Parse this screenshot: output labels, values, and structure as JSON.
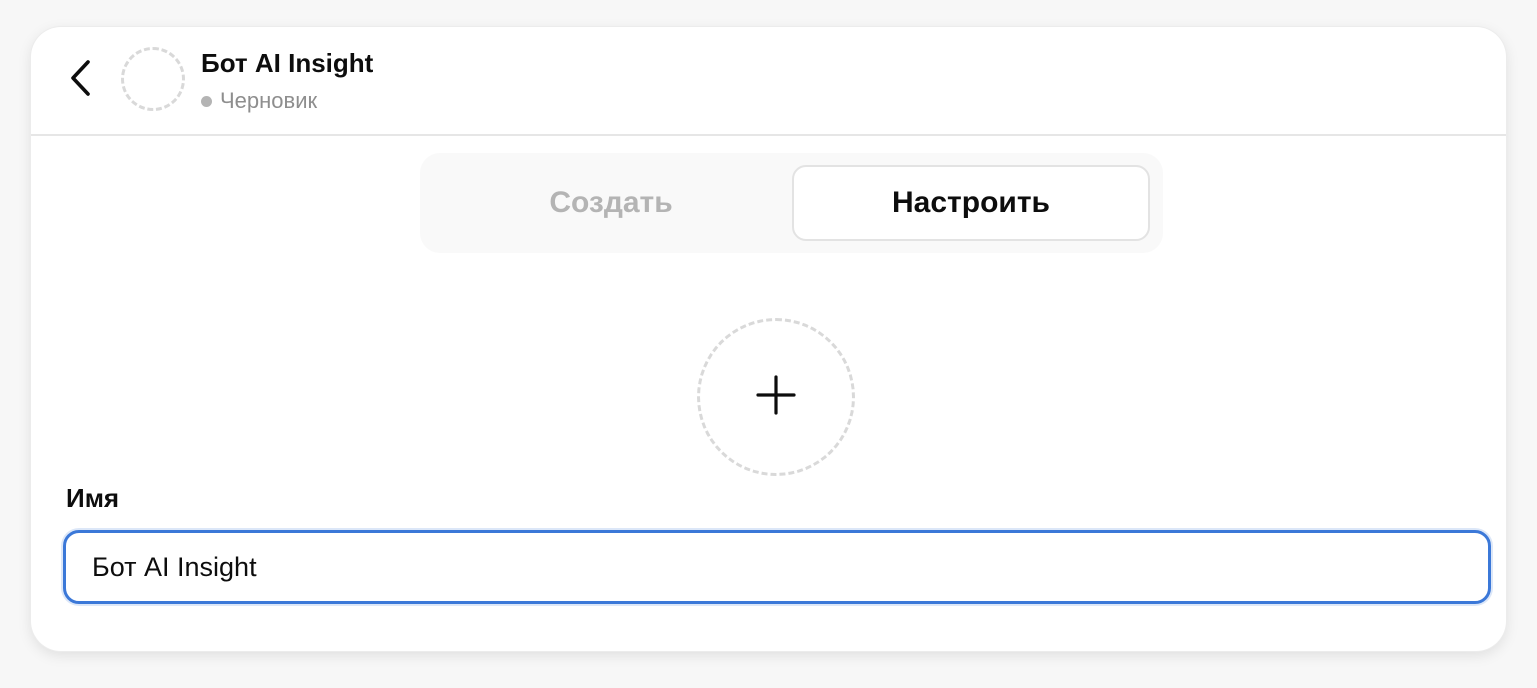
{
  "header": {
    "back_icon": "chevron-left-icon",
    "title": "Бот AI Insight",
    "status": "Черновик",
    "status_dot_color": "#b4b4b4"
  },
  "tabs": [
    {
      "label": "Создать",
      "active": false
    },
    {
      "label": "Настроить",
      "active": true
    }
  ],
  "upload": {
    "icon": "plus-icon"
  },
  "form": {
    "name_label": "Имя",
    "name_value": "Бот AI Insight"
  },
  "colors": {
    "focus_border": "#3b78d8",
    "text_primary": "#0d0d0d",
    "text_muted": "#8e8e8e",
    "tab_inactive": "#b4b4b4"
  }
}
